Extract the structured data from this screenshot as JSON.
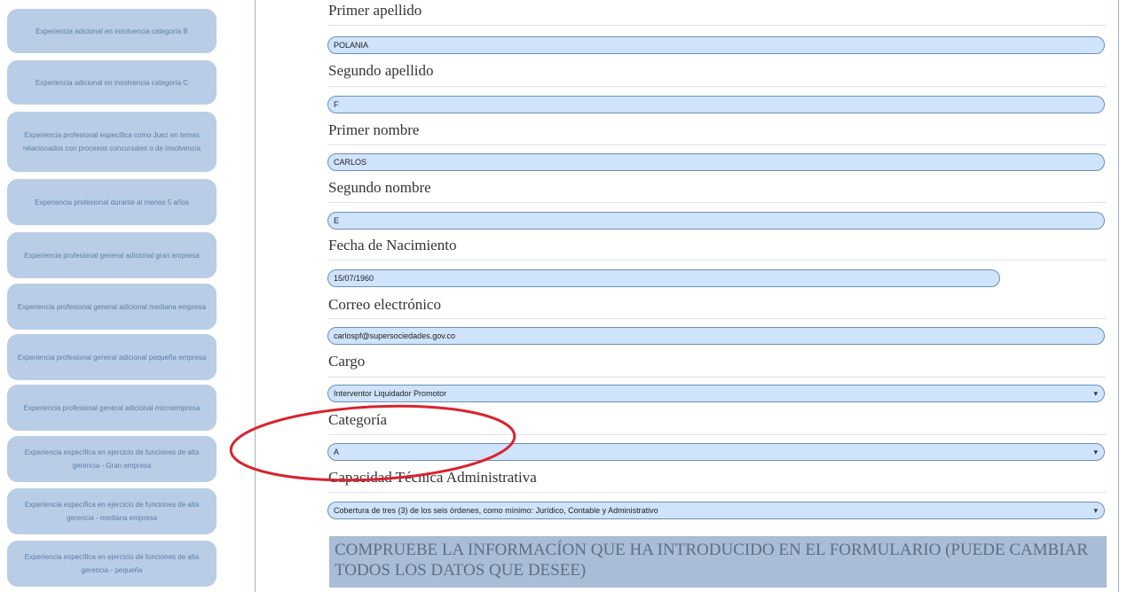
{
  "sidebar": {
    "items": [
      {
        "label": "Experiencia adicional en insolvencia categoría B"
      },
      {
        "label": "Experiencia adicional en insolvencia categoría C"
      },
      {
        "label": "Experiencia profesional específica como Juez en temas relacionados con procesos concursales o de Insolvencia"
      },
      {
        "label": "Experiencia profesional durante al menos 5 años"
      },
      {
        "label": "Experiencia profesional general adicional gran empresa"
      },
      {
        "label": "Experiencia profesional general adicional mediana empresa"
      },
      {
        "label": "Experiencia profesional general adicional pequeña empresa"
      },
      {
        "label": "Experiencia profesional general adicional microempresa"
      },
      {
        "label": "Experiencia específica en ejercicio de funciones de alta gerencia - Gran empresa"
      },
      {
        "label": "Experiencia específica en ejercicio de funciones de alta gerencia - mediana empresa"
      },
      {
        "label": "Experiencia específica en ejercicio de funciones de alta gerencia - pequeña"
      }
    ]
  },
  "form": {
    "primer_apellido": {
      "label": "Primer apellido",
      "value": "POLANIA"
    },
    "segundo_apellido": {
      "label": "Segundo apellido",
      "value": "F"
    },
    "primer_nombre": {
      "label": "Primer nombre",
      "value": "CARLOS"
    },
    "segundo_nombre": {
      "label": "Segundo nombre",
      "value": "E"
    },
    "fecha_nacimiento": {
      "label": "Fecha de Nacimiento",
      "value": "15/07/1960"
    },
    "correo": {
      "label": "Correo electrónico",
      "value": "carlospf@supersociedades.gov.co"
    },
    "cargo": {
      "label": "Cargo",
      "value": "Interventor Liquidador Promotor"
    },
    "categoria": {
      "label": "Categoría",
      "value": "A"
    },
    "capacidad": {
      "label": "Capacidad Técnica Administrativa",
      "value": "Cobertura de tres (3) de los seis órdenes, como mínimo: Jurídico, Contable y Administrativo"
    },
    "confirm_text": "COMPRUEBE LA INFORMACÍON QUE HA INTRODUCIDO EN EL FORMULARIO (PUEDE CAMBIAR TODOS LOS DATOS QUE DESEE)"
  },
  "colors": {
    "sidebar_button": "#b9cde6",
    "field_background": "#cfe3fb",
    "annotation": "#d9232e"
  },
  "icons": {
    "select_arrow": "chevron-down-icon"
  }
}
